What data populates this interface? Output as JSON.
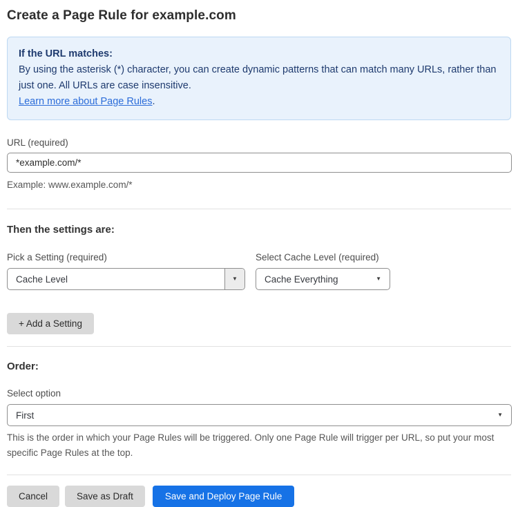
{
  "page": {
    "title": "Create a Page Rule for example.com"
  },
  "info_box": {
    "heading": "If the URL matches:",
    "body": "By using the asterisk (*) character, you can create dynamic patterns that can match many URLs, rather than just one. All URLs are case insensitive.",
    "link_text": "Learn more about Page Rules",
    "link_suffix": "."
  },
  "url_field": {
    "label": "URL (required)",
    "value": "*example.com/*",
    "help": "Example: www.example.com/*"
  },
  "settings_section": {
    "heading": "Then the settings are:",
    "setting_select": {
      "label": "Pick a Setting (required)",
      "value": "Cache Level"
    },
    "cache_level_select": {
      "label": "Select Cache Level (required)",
      "value": "Cache Everything"
    },
    "add_setting_button": "+ Add a Setting"
  },
  "order_section": {
    "heading": "Order:",
    "select_label": "Select option",
    "select_value": "First",
    "help": "This is the order in which your Page Rules will be triggered. Only one Page Rule will trigger per URL, so put your most specific Page Rules at the top."
  },
  "footer": {
    "cancel_label": "Cancel",
    "save_draft_label": "Save as Draft",
    "save_deploy_label": "Save and Deploy Page Rule"
  },
  "icons": {
    "dropdown_arrow": "▼"
  },
  "colors": {
    "info_bg": "#e9f2fc",
    "info_border": "#bdd8f2",
    "info_text": "#1e3a6e",
    "link_blue": "#2b6cd9",
    "primary_button_blue": "#1672e6",
    "gray_button": "#d9d9d9"
  }
}
